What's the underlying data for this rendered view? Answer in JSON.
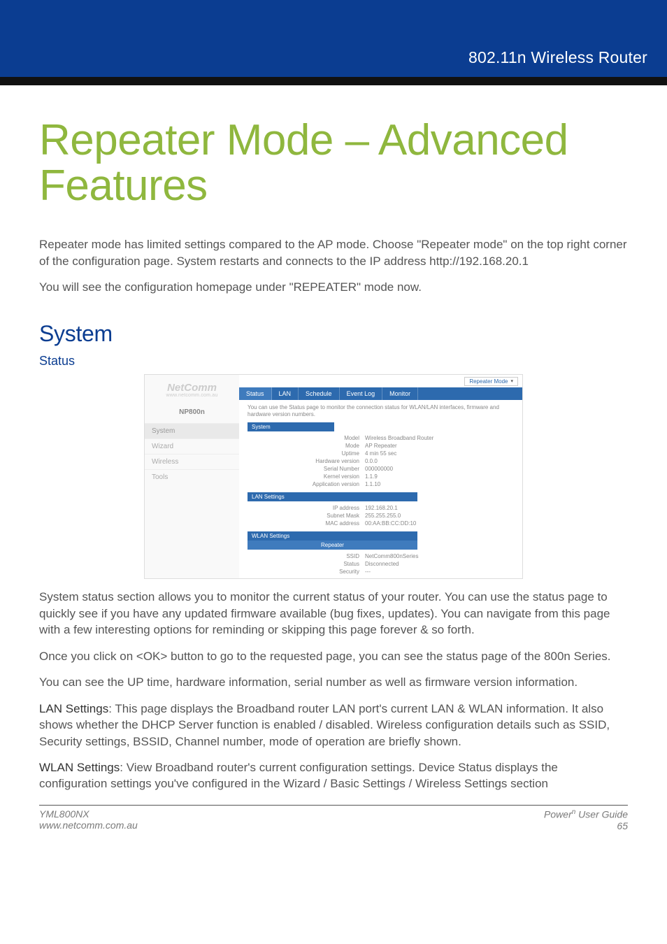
{
  "header": {
    "product_line": "802.11n Wireless Router"
  },
  "title": "Repeater Mode – Advanced Features",
  "intro": [
    "Repeater mode has limited settings compared to the AP mode. Choose \"Repeater mode\" on the top right corner of the configuration page. System restarts and connects to the IP address http://192.168.20.1",
    "You will see the configuration homepage under \"REPEATER\" mode now."
  ],
  "section_h2": "System",
  "section_h3": "Status",
  "router_ui": {
    "brand": "NetComm",
    "brand_sub": "www.netcomm.com.au",
    "model": "NP800n",
    "mode_selector": "Repeater Mode",
    "nav": [
      "System",
      "Wizard",
      "Wireless",
      "Tools"
    ],
    "tabs": [
      "Status",
      "LAN",
      "Schedule",
      "Event Log",
      "Monitor"
    ],
    "hint": "You can use the Status page to monitor the connection status for WLAN/LAN interfaces, firmware and hardware version numbers.",
    "sections": {
      "system": {
        "title": "System",
        "rows": [
          {
            "k": "Model",
            "v": "Wireless Broadband Router"
          },
          {
            "k": "Mode",
            "v": "AP Repeater"
          },
          {
            "k": "Uptime",
            "v": "4 min 55 sec"
          },
          {
            "k": "Hardware version",
            "v": "0.0.0"
          },
          {
            "k": "Serial Number",
            "v": "000000000"
          },
          {
            "k": "Kernel version",
            "v": "1.1.9"
          },
          {
            "k": "Application version",
            "v": "1.1.10"
          }
        ]
      },
      "lan": {
        "title": "LAN Settings",
        "rows": [
          {
            "k": "IP address",
            "v": "192.168.20.1"
          },
          {
            "k": "Subnet Mask",
            "v": "255.255.255.0"
          },
          {
            "k": "MAC address",
            "v": "00:AA:BB:CC:DD:10"
          }
        ]
      },
      "wlan": {
        "title": "WLAN Settings",
        "sub": "Repeater",
        "rows": [
          {
            "k": "SSID",
            "v": "NetComm800nSeries"
          },
          {
            "k": "Status",
            "v": "Disconnected"
          },
          {
            "k": "Security",
            "v": "---"
          }
        ]
      }
    }
  },
  "body_paragraphs": [
    "System status section allows you to monitor the current status of your router. You can use the status page to quickly see if you have any updated firmware available (bug fixes, updates). You can navigate from this page with a few interesting options for reminding or skipping this page forever & so forth.",
    "Once you click on <OK> button to go to the requested page, you can see the status page of the 800n Series.",
    "You can see the UP time, hardware information, serial number as well as firmware version information."
  ],
  "labeled_paragraphs": [
    {
      "label": "LAN Settings",
      "text": ": This page displays the Broadband router LAN port's current LAN & WLAN information. It also shows whether the DHCP Server function is enabled / disabled. Wireless configuration details such as SSID, Security settings, BSSID, Channel number, mode of operation are briefly shown."
    },
    {
      "label": "WLAN Settings",
      "text": ": View Broadband router's current configuration settings. Device Status displays the configuration settings you've configured in the Wizard / Basic Settings / Wireless Settings section"
    }
  ],
  "footer": {
    "left_top": "YML800NX",
    "left_bottom": "www.netcomm.com.au",
    "right_brand": "Power",
    "right_sup": "n",
    "right_rest": " User Guide",
    "page_number": "65"
  }
}
